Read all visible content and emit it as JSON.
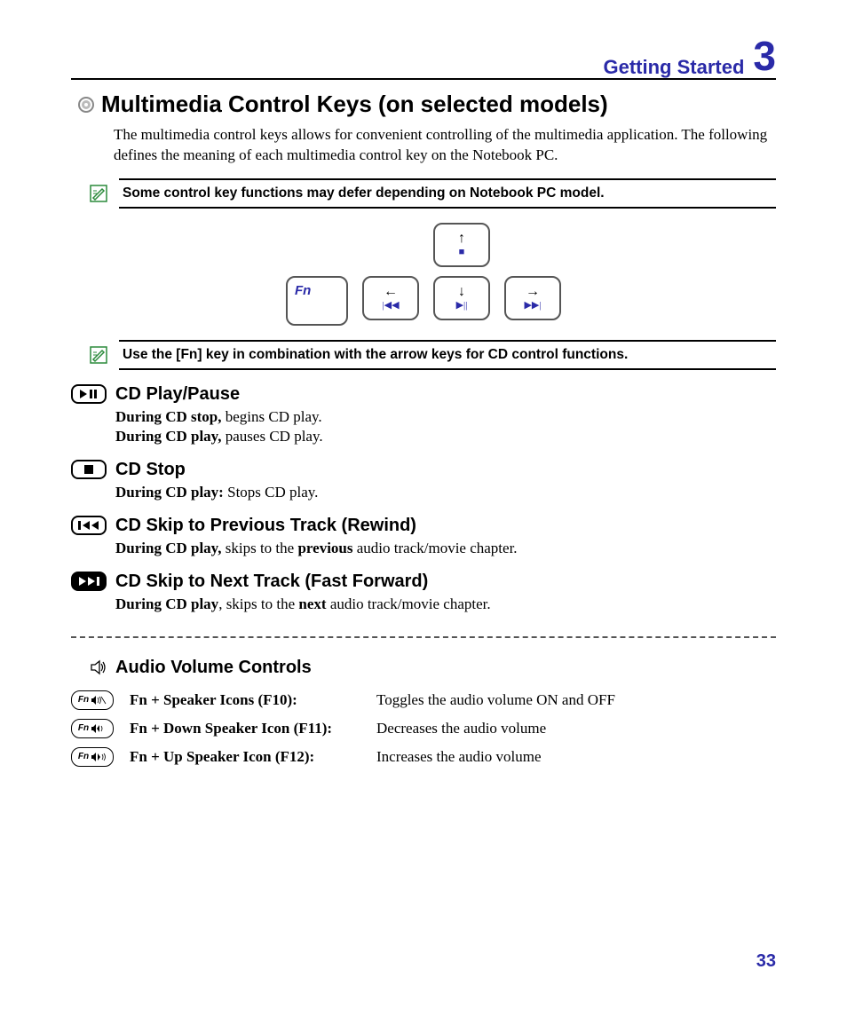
{
  "header": {
    "section": "Getting Started",
    "chapter": "3"
  },
  "title": "Multimedia Control Keys (on selected models)",
  "intro": "The multimedia control keys allows for convenient controlling of the multimedia application. The following defines the meaning of each multimedia control key on the Notebook PC.",
  "note1": "Some control key functions may defer depending on Notebook PC model.",
  "fn_label": "Fn",
  "note2": "Use the [Fn] key in combination with the arrow keys for CD control functions.",
  "sections": {
    "play": {
      "title": "CD Play/Pause",
      "line1_b": "During CD stop,",
      "line1_r": " begins CD play.",
      "line2_b": "During CD play,",
      "line2_r": " pauses CD play."
    },
    "stop": {
      "title": "CD Stop",
      "line1_b": "During CD play:",
      "line1_r": " Stops CD play."
    },
    "prev": {
      "title": "CD Skip to Previous Track (Rewind)",
      "line1_b": "During CD play,",
      "line1_r1": " skips to the ",
      "line1_b2": "previous",
      "line1_r2": " audio track/movie chapter."
    },
    "next": {
      "title": "CD Skip to Next Track (Fast Forward)",
      "line1_b": "During CD play",
      "line1_r1": ", skips to the ",
      "line1_b2": "next",
      "line1_r2": " audio track/movie chapter."
    }
  },
  "audio": {
    "title": "Audio Volume Controls",
    "rows": [
      {
        "key": "Fn",
        "label": "Fn + Speaker Icons (F10):",
        "desc": "Toggles the audio volume ON and OFF"
      },
      {
        "key": "Fn",
        "label": "Fn + Down Speaker Icon (F11):",
        "desc": "Decreases the audio volume"
      },
      {
        "key": "Fn",
        "label": "Fn + Up Speaker Icon (F12):",
        "desc": "Increases the audio volume"
      }
    ]
  },
  "page": "33"
}
